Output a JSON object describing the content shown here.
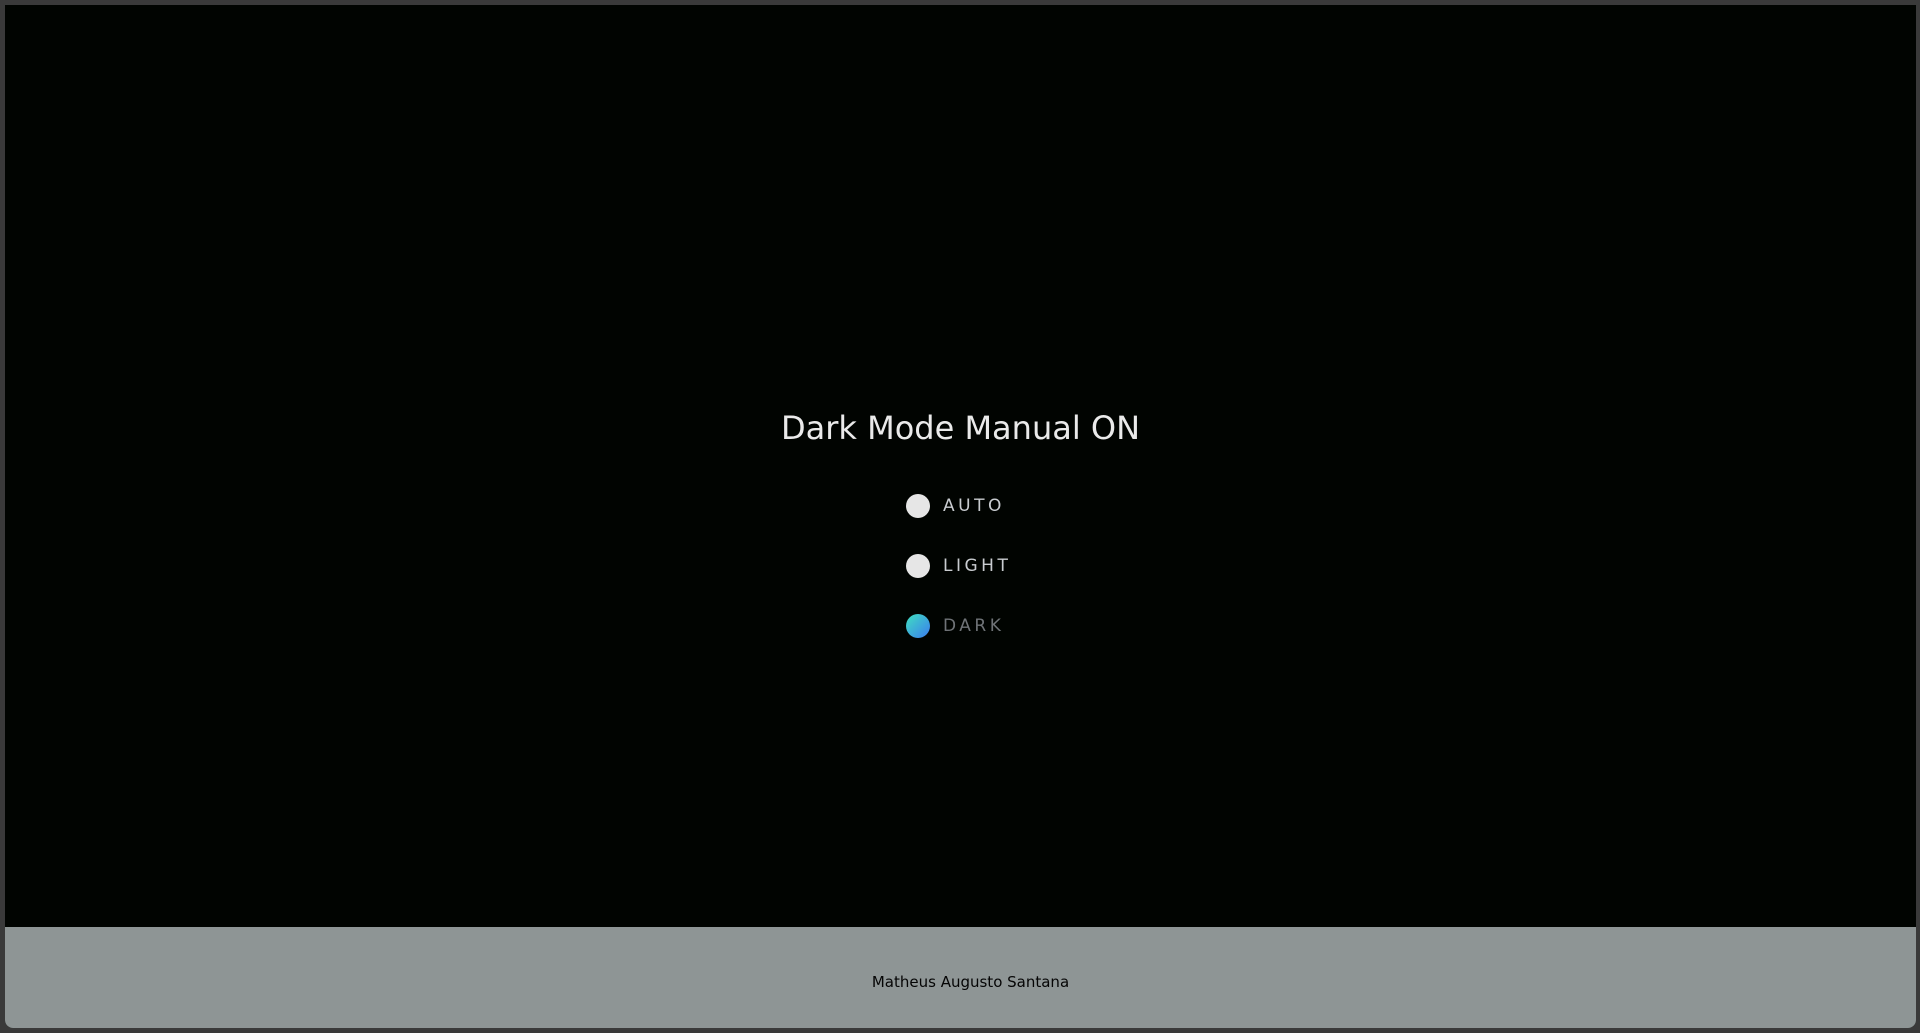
{
  "title": "Dark Mode Manual ON",
  "options": [
    {
      "label": "AUTO",
      "selected": false
    },
    {
      "label": "LIGHT",
      "selected": false
    },
    {
      "label": "DARK",
      "selected": true
    }
  ],
  "footer": {
    "author": "Matheus Augusto Santana"
  },
  "colors": {
    "background": "#010401",
    "footer": "#8e9595",
    "accent_start": "#3fe0c0",
    "accent_end": "#3b7cf0"
  }
}
